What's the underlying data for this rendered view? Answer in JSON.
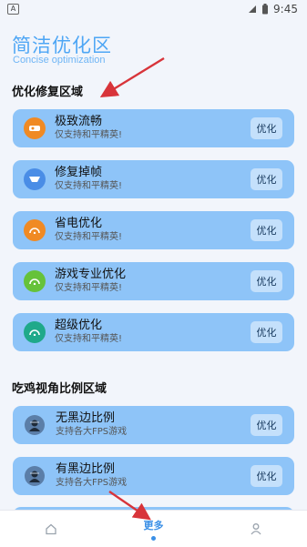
{
  "statusbar": {
    "time": "9:45"
  },
  "header": {
    "title": "简洁优化区",
    "subtitle": "Concise optimization"
  },
  "section_optimize": {
    "title": "优化修复区域",
    "items": [
      {
        "name": "极致流畅",
        "desc": "仅支持和平精英!",
        "button": "优化",
        "icon": "speed-icon",
        "color": "#f08a24"
      },
      {
        "name": "修复掉帧",
        "desc": "仅支持和平精英!",
        "button": "优化",
        "icon": "repair-icon",
        "color": "#4a8de6"
      },
      {
        "name": "省电优化",
        "desc": "仅支持和平精英!",
        "button": "优化",
        "icon": "battery-icon",
        "color": "#f08a24"
      },
      {
        "name": "游戏专业优化",
        "desc": "仅支持和平精英!",
        "button": "优化",
        "icon": "gamepad-icon",
        "color": "#66c23a"
      },
      {
        "name": "超级优化",
        "desc": "仅支持和平精英!",
        "button": "优化",
        "icon": "rocket-icon",
        "color": "#1fa98a"
      }
    ]
  },
  "section_ratio": {
    "title": "吃鸡视角比例区域",
    "items": [
      {
        "name": "无黑边比例",
        "desc": "支持各大FPS游戏",
        "button": "优化",
        "icon": "soldier-avatar-icon"
      },
      {
        "name": "有黑边比例",
        "desc": "支持各大FPS游戏",
        "button": "优化",
        "icon": "soldier-avatar-icon"
      }
    ]
  },
  "bottom_nav": {
    "home_icon": "home-icon",
    "center_label": "更多",
    "profile_icon": "person-icon"
  },
  "colors": {
    "accent": "#4ea6f5",
    "card": "#8ec4f8",
    "button": "#c4e0fb",
    "arrow": "#d8343a"
  }
}
